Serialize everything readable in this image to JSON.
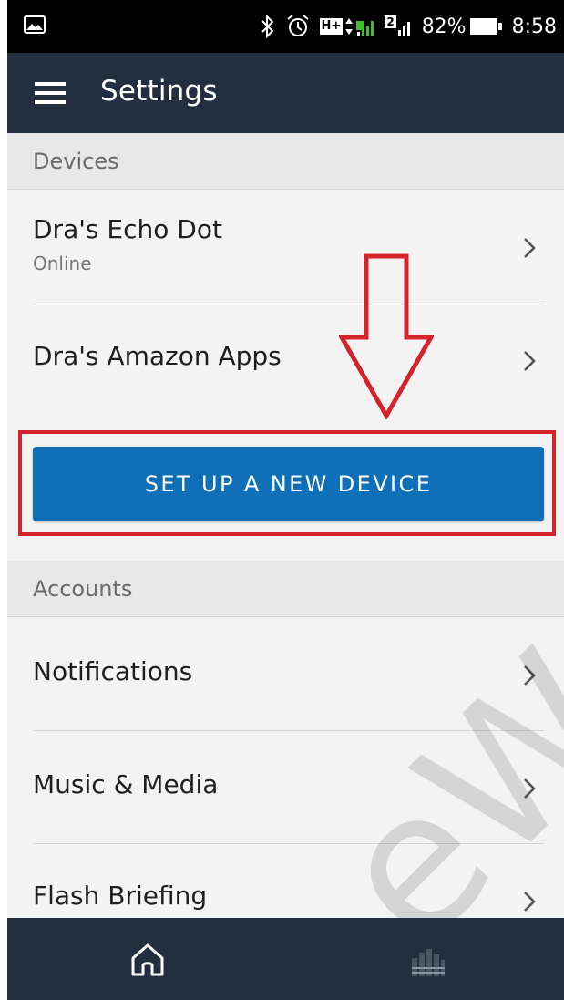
{
  "status_bar": {
    "battery_percent": "82%",
    "time": "8:58",
    "network_label": "H+",
    "sim2_label": "2",
    "icons": [
      "image-icon",
      "bluetooth-icon",
      "alarm-icon",
      "network-icon",
      "signal-icon",
      "signal-2-icon",
      "battery-icon"
    ]
  },
  "app_bar": {
    "title": "Settings",
    "menu_icon": "hamburger-menu-icon"
  },
  "devices_section": {
    "header": "Devices",
    "items": [
      {
        "title": "Dra's Echo Dot",
        "subtitle": "Online"
      },
      {
        "title": "Dra's Amazon Apps",
        "subtitle": ""
      }
    ],
    "setup_button": "SET UP A NEW DEVICE"
  },
  "accounts_section": {
    "header": "Accounts",
    "items": [
      {
        "title": "Notifications"
      },
      {
        "title": "Music & Media"
      },
      {
        "title": "Flash Briefing"
      }
    ]
  },
  "watermark": "eW",
  "bottom_nav": {
    "items": [
      "home-icon",
      "now-playing-icon"
    ]
  },
  "colors": {
    "app_bar": "#232f3e",
    "button": "#0f70b7",
    "annotation": "#d4242b"
  }
}
